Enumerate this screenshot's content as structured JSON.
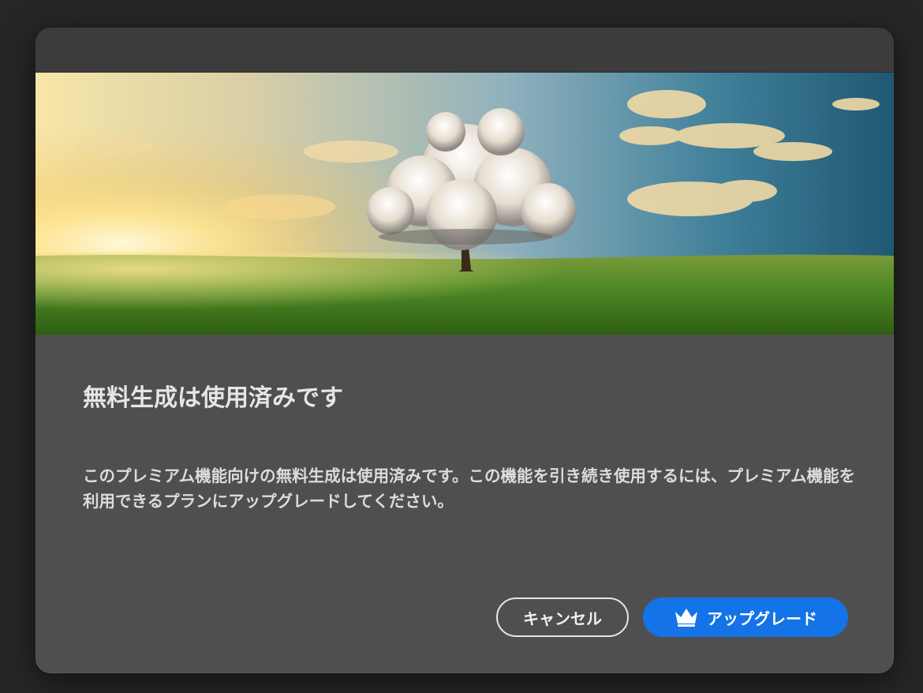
{
  "dialog": {
    "heading": "無料生成は使用済みです",
    "body": "このプレミアム機能向けの無料生成は使用済みです。この機能を引き続き使用するには、プレミアム機能を利用できるプランにアップグレードしてください。",
    "cancel_label": "キャンセル",
    "upgrade_label": "アップグレード",
    "upgrade_icon": "crown-icon",
    "colors": {
      "background": "#4f4f4f",
      "titlebar": "#3c3c3c",
      "accent": "#1473e6"
    }
  }
}
